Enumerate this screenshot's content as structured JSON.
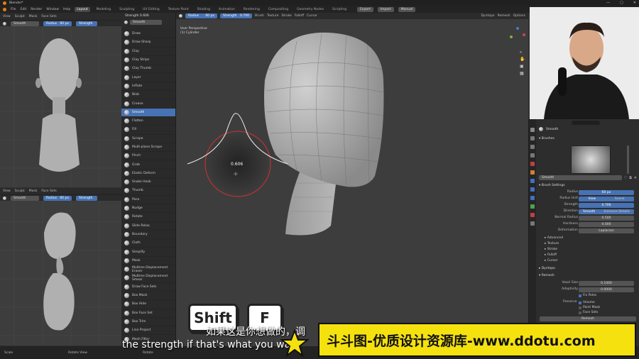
{
  "app": {
    "title": "Blender*",
    "menu": [
      "File",
      "Edit",
      "Render",
      "Window",
      "Help"
    ],
    "workspace_tabs": [
      "Layout",
      "Modeling",
      "Sculpting",
      "UV Editing",
      "Texture Paint",
      "Shading",
      "Animation",
      "Rendering",
      "Compositing",
      "Geometry Nodes",
      "Scripting"
    ],
    "active_tab": "Layout",
    "top_right": {
      "scene": "Scene",
      "view_layer": "ViewLayer"
    },
    "extra_buttons": [
      "Export",
      "Import",
      "Manual"
    ]
  },
  "left_top_vp": {
    "menu": [
      "View",
      "Sculpt",
      "Mask",
      "Face Sets"
    ],
    "brush": "Smooth",
    "radius_label": "Radius",
    "radius": "60 px",
    "strength_label": "Strength"
  },
  "left_bottom_vp": {
    "menu": [
      "View",
      "Sculpt",
      "Mask",
      "Face Sets"
    ],
    "brush": "Smooth",
    "radius_label": "Radius",
    "radius": "60 px",
    "strength_label": "Strength"
  },
  "tool_popup": {
    "title": "Strength 0.606",
    "items": [
      "Draw",
      "Draw Sharp",
      "Clay",
      "Clay Strips",
      "Clay Thumb",
      "Layer",
      "Inflate",
      "Blob",
      "Crease",
      "Smooth",
      "Flatten",
      "Fill",
      "Scrape",
      "Multi-plane Scrape",
      "Pinch",
      "Grab",
      "Elastic Deform",
      "Snake Hook",
      "Thumb",
      "Pose",
      "Nudge",
      "Rotate",
      "Slide Relax",
      "Boundary",
      "Cloth",
      "Simplify",
      "Mask",
      "Multires Displacement Eraser",
      "Multires Displacement Smear",
      "Draw Face Sets",
      "Box Mask",
      "Box Hide",
      "Box Face Set",
      "Box Trim",
      "Line Project",
      "Mesh Filter"
    ],
    "active": "Smooth"
  },
  "main_vp": {
    "brush": "Smooth",
    "radius_label": "Radius",
    "radius": "60 px",
    "strength_label": "Strength",
    "strength": "0.700",
    "menus": [
      "Brush",
      "Texture",
      "Stroke",
      "Falloff",
      "Cursor"
    ],
    "overlay_label": "Dyntopo",
    "remesh_label": "Remesh",
    "options_label": "Options",
    "view_title": "User Perspective",
    "object_name": "(1) Cylinder",
    "strength_readout": "0.606"
  },
  "properties": {
    "brush_name": "Smooth",
    "section_brushes": "Brushes",
    "brush_field": "Smooth",
    "section_brush_settings": "Brush Settings",
    "rows": [
      {
        "k": "Radius",
        "v": "60 px",
        "blue": true
      },
      {
        "k": "Radius Unit",
        "v": "View",
        "v2": "Scene",
        "blue": true
      },
      {
        "k": "Strength",
        "v": "0.700",
        "blue": true
      },
      {
        "k": "Direction",
        "v": "Smooth",
        "v2": "Enhance Details",
        "blue": true
      },
      {
        "k": "Normal Radius",
        "v": "0.500",
        "blue": false
      },
      {
        "k": "Hardness",
        "v": "0.000",
        "blue": false
      },
      {
        "k": "Deformation",
        "v": "Laplacian",
        "blue": false
      }
    ],
    "subsections": [
      "Advanced",
      "Texture",
      "Stroke",
      "Falloff",
      "Cursor"
    ],
    "section_dyntopo": "Dyntopo",
    "section_remesh": "Remesh",
    "remesh_rows": [
      {
        "k": "Voxel Size",
        "v": "0.1000"
      },
      {
        "k": "Adaptivity",
        "v": "0.0000"
      }
    ],
    "fix_poles": "Fix Poles",
    "preserve_label": "Preserve",
    "preserve": [
      "Volume",
      "Paint Mask",
      "Face Sets"
    ],
    "remesh_button": "Remesh"
  },
  "statusbar": {
    "items": [
      "Scale",
      "Rotate View",
      "Rotate"
    ]
  },
  "keys": {
    "key1": "Shift",
    "key2": "F"
  },
  "subtitles": {
    "zh": "如果这是你想做的，调",
    "en": "the strength if that's what you want"
  },
  "watermark": {
    "text": "斗斗图-优质设计资源库-www.ddotu.com"
  },
  "colors": {
    "accent": "#4772b3",
    "watermark_bg": "#f5e10e",
    "brush_circle": "#d03030"
  }
}
